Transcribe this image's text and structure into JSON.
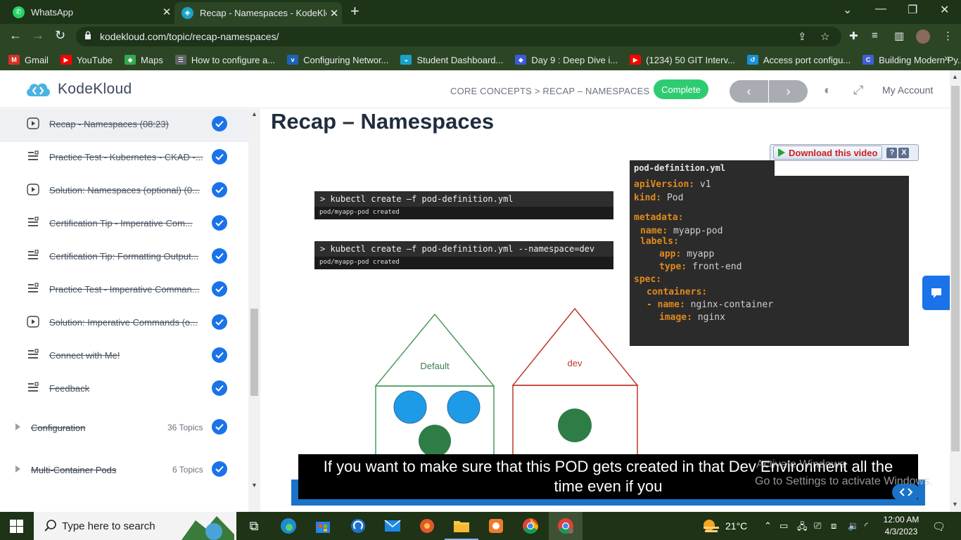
{
  "browser": {
    "tabs": [
      {
        "title": "WhatsApp",
        "active": false
      },
      {
        "title": "Recap - Namespaces - KodeKloud",
        "active": true
      }
    ],
    "url": "kodekloud.com/topic/recap-namespaces/",
    "bookmarks": [
      {
        "label": "Gmail",
        "color": "#d93025",
        "glyph": "M"
      },
      {
        "label": "YouTube",
        "color": "#ff0000",
        "glyph": "▶"
      },
      {
        "label": "Maps",
        "color": "#34a853",
        "glyph": "◆"
      },
      {
        "label": "How to configure a...",
        "color": "#5f6368",
        "glyph": "☰"
      },
      {
        "label": "Configuring Networ...",
        "color": "#1f63b7",
        "glyph": "v"
      },
      {
        "label": "Student Dashboard...",
        "color": "#1aa3c8",
        "glyph": "◒"
      },
      {
        "label": "Day 9 : Deep Dive i...",
        "color": "#3b5bdb",
        "glyph": "◆"
      },
      {
        "label": "(1234) 50 GIT Interv...",
        "color": "#ff0000",
        "glyph": "▶"
      },
      {
        "label": "Access port configu...",
        "color": "#1a8fd9",
        "glyph": "↺"
      },
      {
        "label": "Building Modern Py...",
        "color": "#3f5fd4",
        "glyph": "C"
      }
    ]
  },
  "header": {
    "logo_text": "KodeKloud",
    "breadcrumb": "CORE CONCEPTS > RECAP – NAMESPACES",
    "complete_label": "Complete",
    "prev_label": "‹",
    "next_label": "›",
    "account_label": "My Account"
  },
  "sidebar": {
    "items": [
      {
        "label": "Recap - Namespaces (08:23)",
        "type": "video",
        "active": true
      },
      {
        "label": "Practice Test - Kubernetes - CKAD -...",
        "type": "text"
      },
      {
        "label": "Solution: Namespaces (optional) (0...",
        "type": "video"
      },
      {
        "label": "Certification Tip - Imperative Com...",
        "type": "text"
      },
      {
        "label": "Certification Tip: Formatting Output...",
        "type": "text"
      },
      {
        "label": "Practice Test - Imperative Comman...",
        "type": "text"
      },
      {
        "label": "Solution: Imperative Commands (o...",
        "type": "video"
      },
      {
        "label": "Connect with Me!",
        "type": "text"
      },
      {
        "label": "Feedback",
        "type": "text"
      }
    ],
    "sections": [
      {
        "label": "Configuration",
        "count": "36 Topics"
      },
      {
        "label": "Multi-Container Pods",
        "count": "6 Topics"
      }
    ]
  },
  "lesson": {
    "title": "Recap – Namespaces",
    "download_label": "Download this video",
    "help_label": "?",
    "close_label": "X",
    "terminals": [
      {
        "cmd": "> kubectl create –f pod-definition.yml",
        "out": "pod/myapp-pod created"
      },
      {
        "cmd": "> kubectl create –f pod-definition.yml --namespace=dev",
        "out": "pod/myapp-pod created"
      }
    ],
    "yaml_filename": "pod-definition.yml",
    "yaml": {
      "apiVersion_key": "apiVersion:",
      "apiVersion_val": "v1",
      "kind_key": "kind:",
      "kind_val": "Pod",
      "metadata_key": "metadata:",
      "name_key": "name:",
      "name_val": "myapp-pod",
      "labels_key": "labels:",
      "app_key": "app:",
      "app_val": "myapp",
      "type_key": "type:",
      "type_val": "front-end",
      "spec_key": "spec:",
      "containers_key": "containers:",
      "cname_dash": "- ",
      "cname_key": "name:",
      "cname_val": "nginx-container",
      "image_key": "image:",
      "image_val": "nginx"
    },
    "diagram": {
      "default_label": "Default",
      "dev_label": "dev",
      "default_color": "#4c9a5e",
      "dev_color": "#c0392b",
      "pod_blue": "#1e9be6",
      "pod_green": "#2e7d46"
    },
    "subtitle_line1": "If you want to make sure that this POD gets created in that Dev Environment all the",
    "subtitle_line2": "time even if you",
    "activate_line1": "Activate Windows",
    "activate_line2": "Go to Settings to activate Windows."
  },
  "taskbar": {
    "search_placeholder": "Type here to search",
    "temperature": "21°C",
    "time": "12:00 AM",
    "date": "4/3/2023"
  }
}
